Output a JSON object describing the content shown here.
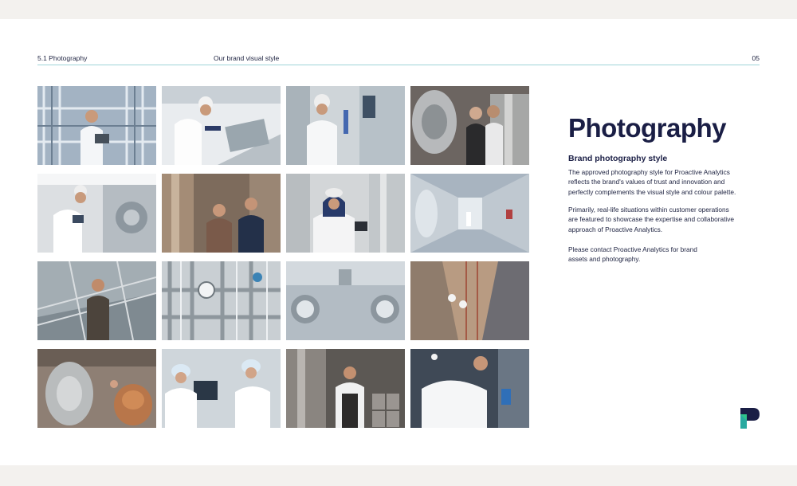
{
  "header": {
    "section": "5.1 Photography",
    "subtitle": "Our brand visual style",
    "page_number": "05"
  },
  "content": {
    "title": "Photography",
    "subheading": "Brand photography style",
    "paragraph1": [
      "The approved photography style for Proactive Analytics",
      "reflects the brand's values of trust and innovation and",
      "perfectly complements the visual style and colour palette."
    ],
    "paragraph2": [
      "Primarily, real-life situations within customer operations",
      "are featured to showcase the expertise and collaborative",
      "approach of Proactive Analytics."
    ],
    "paragraph3": [
      "Please contact Proactive Analytics for brand",
      "assets and photography."
    ]
  },
  "logo": {
    "icon": "proactive-analytics-logo-icon",
    "dark": "#1a1e45",
    "accent": "#2fc48a"
  },
  "photos": [
    {
      "subject": "technician with tablet in pipework plant",
      "icon": "photo-icon"
    },
    {
      "subject": "worker in hairnet at control panel",
      "icon": "photo-icon"
    },
    {
      "subject": "woman in hairnet at touchscreen",
      "icon": "photo-icon"
    },
    {
      "subject": "two men beside steel tanks",
      "icon": "photo-icon"
    },
    {
      "subject": "woman with tablet at machinery",
      "icon": "photo-icon"
    },
    {
      "subject": "two men in brewery",
      "icon": "photo-icon"
    },
    {
      "subject": "woman in hijab with tablet",
      "icon": "photo-icon"
    },
    {
      "subject": "steel tank corridor",
      "icon": "photo-icon"
    },
    {
      "subject": "man on plant stairway",
      "icon": "photo-icon"
    },
    {
      "subject": "stainless pipework and gauges",
      "icon": "photo-icon"
    },
    {
      "subject": "steel tank outlet valves",
      "icon": "photo-icon"
    },
    {
      "subject": "aerial view of workers between tanks",
      "icon": "photo-icon"
    },
    {
      "subject": "copper brewing vessels",
      "icon": "photo-icon"
    },
    {
      "subject": "two women in hairnets with tablet",
      "icon": "photo-icon"
    },
    {
      "subject": "brewer with tablet among kegs",
      "icon": "photo-icon"
    },
    {
      "subject": "technician adjusting equipment",
      "icon": "photo-icon"
    }
  ]
}
